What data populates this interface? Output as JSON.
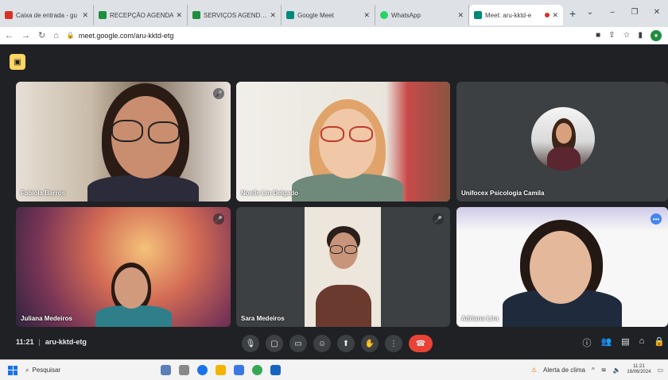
{
  "browser": {
    "tabs": [
      {
        "label": "Caixa de entrada - gu",
        "icon": "gmail-icon",
        "color": "#d93025"
      },
      {
        "label": "RECEPÇÃO AGENDA",
        "icon": "sheets-icon",
        "color": "#1e8e3e"
      },
      {
        "label": "SERVIÇOS AGENDAM",
        "icon": "sheets-icon",
        "color": "#1e8e3e"
      },
      {
        "label": "Google Meet",
        "icon": "meet-icon",
        "color": "#00897b"
      },
      {
        "label": "WhatsApp",
        "icon": "whatsapp-icon",
        "color": "#25d366"
      },
      {
        "label": "Meet: aru-kktd-e",
        "icon": "meet-icon",
        "color": "#00897b",
        "active": true
      }
    ],
    "url": "meet.google.com/aru-kktd-etg"
  },
  "meet": {
    "participants": [
      {
        "name": "Fabiola Barros"
      },
      {
        "name": "Noelle Lin Delgado"
      },
      {
        "name": "Unifocex Psicologia Camila"
      },
      {
        "name": "Juliana Medeiros"
      },
      {
        "name": "Sara Medeiros"
      },
      {
        "name": "Adriana Lira"
      }
    ],
    "time": "11:21",
    "meeting_code": "aru-kktd-etg"
  },
  "taskbar": {
    "search_label": "Pesquisar",
    "alert_label": "Alerta de clima",
    "clock_time": "11:21",
    "clock_date": "18/06/2024"
  }
}
